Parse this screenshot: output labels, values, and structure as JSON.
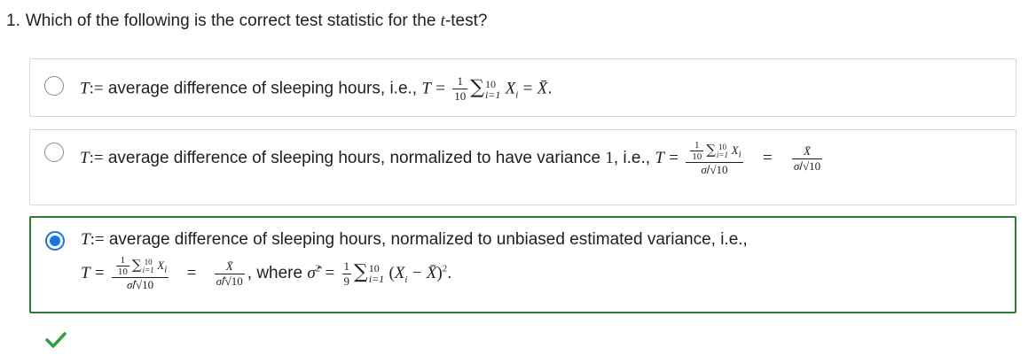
{
  "question": {
    "number": "1.",
    "text_before": "Which of the following is the correct test statistic for the",
    "t_symbol": "t",
    "text_after": "-test?"
  },
  "options": [
    {
      "selected": false,
      "text": "average difference of sleeping hours, i.e.,"
    },
    {
      "selected": false,
      "text": "average difference of sleeping hours, normalized to have variance",
      "variance_value": "1",
      "ie": ", i.e.,"
    },
    {
      "selected": true,
      "correct": true,
      "text": "average difference of sleeping hours, normalized to unbiased estimated variance, i.e.,",
      "where": "where"
    }
  ],
  "math": {
    "T": "T",
    "assign": ":=",
    "equals": "=",
    "one": "1",
    "ten": "10",
    "nine": "9",
    "i1": "i=1",
    "Xi": "X",
    "Xbar": "X̄",
    "sigma": "σ",
    "sigmahat": "σ̂",
    "sqrt10": "√10"
  },
  "colors": {
    "correct_border": "#2e7d32",
    "radio_selected": "#1a73e8",
    "check": "#2e9e44"
  },
  "icons": {
    "feedback": "check-icon"
  }
}
